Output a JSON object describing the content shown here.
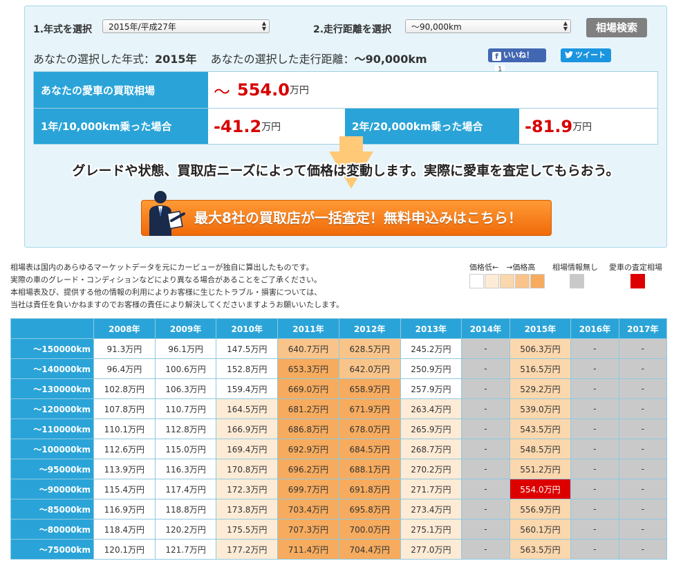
{
  "selector": {
    "year_label": "1.年式を選択",
    "year_value": "2015年/平成27年",
    "distance_label": "2.走行距離を選択",
    "distance_value": "〜90,000km",
    "search_button": "相場検索"
  },
  "chosen": {
    "year_prefix": "あなたの選択した年式：",
    "year": "2015年",
    "distance_prefix": "あなたの選択した走行距離：",
    "distance": "〜90,000km"
  },
  "social": {
    "like_label": "いいね！",
    "like_count": "1",
    "tweet_label": "ツイート"
  },
  "price": {
    "current_label": "あなたの愛車の買取相場",
    "current_prefix": "〜",
    "current_value": "554.0",
    "unit": "万円",
    "one_year_label": "1年/10,000km乗った場合",
    "one_year_value": "-41.2",
    "two_year_label": "2年/20,000km乗った場合",
    "two_year_value": "-81.9"
  },
  "notice": "グレードや状態、買取店ニーズによって価格は変動します。実際に愛車を査定してもらおう。",
  "cta_label": "最大8社の買取店が一括査定！無料申込みはこちら！",
  "disclaimer": [
    "相場表は国内のあらゆるマーケットデータを元にカービューが独自に算出したものです。",
    "実際の車のグレード・コンディションなどにより異なる場合があることをご了承ください。",
    "本相場表及び、提供する他の情報の利用によりお客様に生じたトラブル・損害については、",
    "当社は責任を負いかねますのでお客様の責任により解決してくださいますようお願いいたします。"
  ],
  "legend": {
    "price_range": "価格低←　→価格高",
    "no_info": "相場情報無し",
    "your_car": "愛車の査定相場",
    "colors": [
      "#ffffff",
      "#fdebd6",
      "#fbd7ad",
      "#f9c48a",
      "#f6ab5e"
    ],
    "no_info_color": "#c9c9c9",
    "your_car_color": "#dd0000"
  },
  "table": {
    "years": [
      "2008年",
      "2009年",
      "2010年",
      "2011年",
      "2012年",
      "2013年",
      "2014年",
      "2015年",
      "2016年",
      "2017年"
    ],
    "rows": [
      {
        "km": "〜150000km",
        "cells": [
          [
            "91.3万円",
            "c0"
          ],
          [
            "96.1万円",
            "c0"
          ],
          [
            "147.5万円",
            "c0"
          ],
          [
            "640.7万円",
            "c3"
          ],
          [
            "628.5万円",
            "c3"
          ],
          [
            "245.2万円",
            "c0"
          ],
          [
            "-",
            "cn"
          ],
          [
            "506.3万円",
            "c2"
          ],
          [
            "-",
            "cn"
          ],
          [
            "-",
            "cn"
          ]
        ]
      },
      {
        "km": "〜140000km",
        "cells": [
          [
            "96.4万円",
            "c0"
          ],
          [
            "100.6万円",
            "c0"
          ],
          [
            "152.8万円",
            "c0"
          ],
          [
            "653.3万円",
            "c4"
          ],
          [
            "642.0万円",
            "c3"
          ],
          [
            "250.9万円",
            "c0"
          ],
          [
            "-",
            "cn"
          ],
          [
            "516.5万円",
            "c2"
          ],
          [
            "-",
            "cn"
          ],
          [
            "-",
            "cn"
          ]
        ]
      },
      {
        "km": "〜130000km",
        "cells": [
          [
            "102.8万円",
            "c0"
          ],
          [
            "106.3万円",
            "c0"
          ],
          [
            "159.4万円",
            "c0"
          ],
          [
            "669.0万円",
            "c4"
          ],
          [
            "658.9万円",
            "c4"
          ],
          [
            "257.9万円",
            "c0"
          ],
          [
            "-",
            "cn"
          ],
          [
            "529.2万円",
            "c2"
          ],
          [
            "-",
            "cn"
          ],
          [
            "-",
            "cn"
          ]
        ]
      },
      {
        "km": "〜120000km",
        "cells": [
          [
            "107.8万円",
            "c0"
          ],
          [
            "110.7万円",
            "c0"
          ],
          [
            "164.5万円",
            "c1"
          ],
          [
            "681.2万円",
            "c4"
          ],
          [
            "671.9万円",
            "c4"
          ],
          [
            "263.4万円",
            "c1"
          ],
          [
            "-",
            "cn"
          ],
          [
            "539.0万円",
            "c2"
          ],
          [
            "-",
            "cn"
          ],
          [
            "-",
            "cn"
          ]
        ]
      },
      {
        "km": "〜110000km",
        "cells": [
          [
            "110.1万円",
            "c0"
          ],
          [
            "112.8万円",
            "c0"
          ],
          [
            "166.9万円",
            "c1"
          ],
          [
            "686.8万円",
            "c4"
          ],
          [
            "678.0万円",
            "c4"
          ],
          [
            "265.9万円",
            "c1"
          ],
          [
            "-",
            "cn"
          ],
          [
            "543.5万円",
            "c2"
          ],
          [
            "-",
            "cn"
          ],
          [
            "-",
            "cn"
          ]
        ]
      },
      {
        "km": "〜100000km",
        "cells": [
          [
            "112.6万円",
            "c0"
          ],
          [
            "115.0万円",
            "c0"
          ],
          [
            "169.4万円",
            "c1"
          ],
          [
            "692.9万円",
            "c4"
          ],
          [
            "684.5万円",
            "c4"
          ],
          [
            "268.7万円",
            "c1"
          ],
          [
            "-",
            "cn"
          ],
          [
            "548.5万円",
            "c2"
          ],
          [
            "-",
            "cn"
          ],
          [
            "-",
            "cn"
          ]
        ]
      },
      {
        "km": "〜95000km",
        "cells": [
          [
            "113.9万円",
            "c0"
          ],
          [
            "116.3万円",
            "c0"
          ],
          [
            "170.8万円",
            "c1"
          ],
          [
            "696.2万円",
            "c4"
          ],
          [
            "688.1万円",
            "c4"
          ],
          [
            "270.2万円",
            "c1"
          ],
          [
            "-",
            "cn"
          ],
          [
            "551.2万円",
            "c2"
          ],
          [
            "-",
            "cn"
          ],
          [
            "-",
            "cn"
          ]
        ]
      },
      {
        "km": "〜90000km",
        "cells": [
          [
            "115.4万円",
            "c0"
          ],
          [
            "117.4万円",
            "c0"
          ],
          [
            "172.3万円",
            "c1"
          ],
          [
            "699.7万円",
            "c4"
          ],
          [
            "691.8万円",
            "c4"
          ],
          [
            "271.7万円",
            "c1"
          ],
          [
            "-",
            "cn"
          ],
          [
            "554.0万円",
            "cr"
          ],
          [
            "-",
            "cn"
          ],
          [
            "-",
            "cn"
          ]
        ]
      },
      {
        "km": "〜85000km",
        "cells": [
          [
            "116.9万円",
            "c0"
          ],
          [
            "118.8万円",
            "c0"
          ],
          [
            "173.8万円",
            "c1"
          ],
          [
            "703.4万円",
            "c4"
          ],
          [
            "695.8万円",
            "c4"
          ],
          [
            "273.4万円",
            "c1"
          ],
          [
            "-",
            "cn"
          ],
          [
            "556.9万円",
            "c2"
          ],
          [
            "-",
            "cn"
          ],
          [
            "-",
            "cn"
          ]
        ]
      },
      {
        "km": "〜80000km",
        "cells": [
          [
            "118.4万円",
            "c0"
          ],
          [
            "120.2万円",
            "c0"
          ],
          [
            "175.5万円",
            "c1"
          ],
          [
            "707.3万円",
            "c4"
          ],
          [
            "700.0万円",
            "c4"
          ],
          [
            "275.1万円",
            "c1"
          ],
          [
            "-",
            "cn"
          ],
          [
            "560.1万円",
            "c2"
          ],
          [
            "-",
            "cn"
          ],
          [
            "-",
            "cn"
          ]
        ]
      },
      {
        "km": "〜75000km",
        "cells": [
          [
            "120.1万円",
            "c0"
          ],
          [
            "121.7万円",
            "c0"
          ],
          [
            "177.2万円",
            "c1"
          ],
          [
            "711.4万円",
            "c4"
          ],
          [
            "704.4万円",
            "c4"
          ],
          [
            "277.0万円",
            "c1"
          ],
          [
            "-",
            "cn"
          ],
          [
            "563.5万円",
            "c2"
          ],
          [
            "-",
            "cn"
          ],
          [
            "-",
            "cn"
          ]
        ]
      }
    ]
  }
}
